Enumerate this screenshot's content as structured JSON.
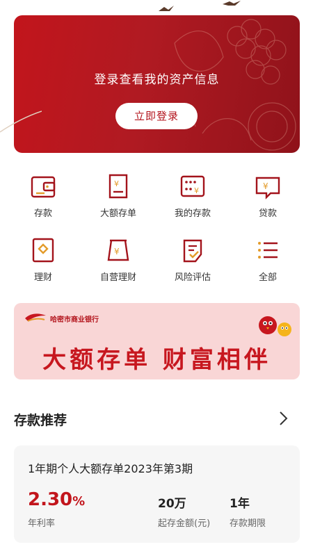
{
  "login": {
    "title": "登录查看我的资产信息",
    "button": "立即登录"
  },
  "quick_menu": [
    {
      "label": "存款",
      "icon": "wallet-icon"
    },
    {
      "label": "大额存单",
      "icon": "certificate-icon"
    },
    {
      "label": "我的存款",
      "icon": "my-deposit-icon"
    },
    {
      "label": "贷款",
      "icon": "loan-icon"
    },
    {
      "label": "理财",
      "icon": "wealth-icon"
    },
    {
      "label": "自营理财",
      "icon": "self-wealth-icon"
    },
    {
      "label": "风险评估",
      "icon": "risk-assessment-icon"
    },
    {
      "label": "全部",
      "icon": "all-menu-icon"
    }
  ],
  "banner": {
    "bank_name": "哈密市商业银行",
    "slogan": "大额存单  财富相伴"
  },
  "deposit_section": {
    "title": "存款推荐",
    "product": {
      "name": "1年期个人大额存单2023年第3期",
      "rate": "2.30",
      "rate_unit": "%",
      "rate_label": "年利率",
      "amount": "20万",
      "amount_label": "起存金额(元)",
      "term": "1年",
      "term_label": "存款期限"
    }
  },
  "colors": {
    "brand_red": "#c2151c",
    "banner_bg": "#f9d6d6",
    "card_bg": "#f6f6f6"
  }
}
